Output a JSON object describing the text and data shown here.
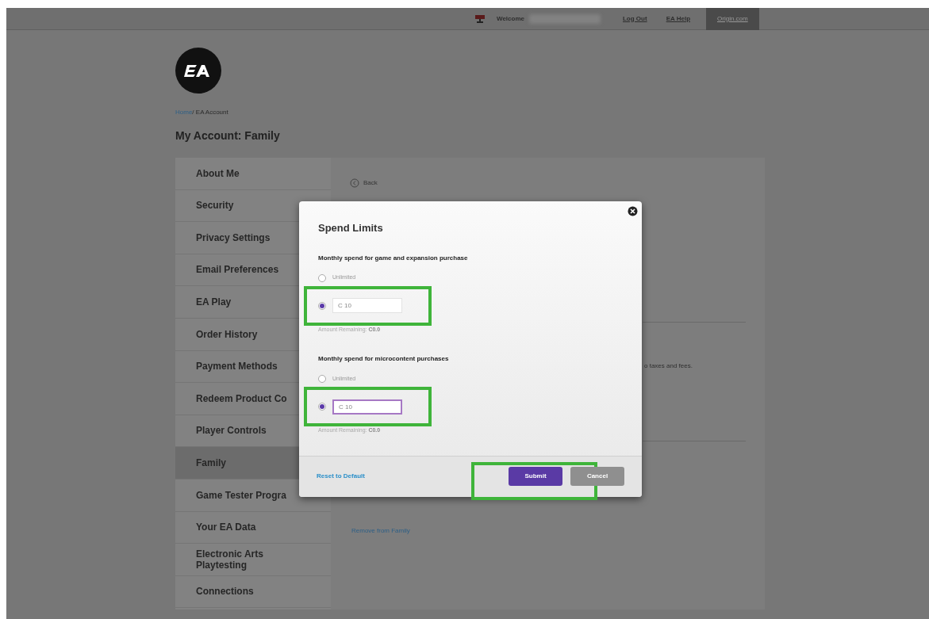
{
  "top_bar": {
    "welcome": "Welcome",
    "links": [
      {
        "label": "Log Out",
        "selected": false
      },
      {
        "label": "EA Help",
        "selected": false
      },
      {
        "label": "Origin.com",
        "selected": true
      }
    ]
  },
  "breadcrumb": {
    "home": "Home",
    "current": "/ EA Account"
  },
  "page_title": "My Account: Family",
  "sidebar": {
    "items": [
      {
        "label": "About Me",
        "selected": false
      },
      {
        "label": "Security",
        "selected": false
      },
      {
        "label": "Privacy Settings",
        "selected": false
      },
      {
        "label": "Email Preferences",
        "selected": false
      },
      {
        "label": "EA Play",
        "selected": false
      },
      {
        "label": "Order History",
        "selected": false
      },
      {
        "label": "Payment Methods",
        "selected": false
      },
      {
        "label": "Redeem Product Co",
        "selected": false
      },
      {
        "label": "Player Controls",
        "selected": false
      },
      {
        "label": "Family",
        "selected": true
      },
      {
        "label": "Game Tester Progra",
        "selected": false
      },
      {
        "label": "Your EA Data",
        "selected": false
      },
      {
        "label": "Electronic Arts Playtesting",
        "selected": false
      },
      {
        "label": "Connections",
        "selected": false
      }
    ]
  },
  "content": {
    "back": "Back",
    "note": "o taxes and fees.",
    "remove_link": "Remove from Family"
  },
  "modal": {
    "title": "Spend Limits",
    "sections": [
      {
        "label": "Monthly spend for game and expansion purchase",
        "options": [
          {
            "kind": "plain",
            "label": "Unlimited",
            "selected": false,
            "highlighted": false
          },
          {
            "kind": "amount",
            "value": "C 10",
            "selected": true,
            "focused": false,
            "highlighted": true
          }
        ],
        "remaining_label": "Amount Remaining:",
        "remaining_value": "C0.0"
      },
      {
        "label": "Monthly spend for microcontent purchases",
        "options": [
          {
            "kind": "plain",
            "label": "Unlimited",
            "selected": false,
            "highlighted": false
          },
          {
            "kind": "amount",
            "value": "C 10",
            "selected": true,
            "focused": true,
            "highlighted": true
          }
        ],
        "remaining_label": "Amount Remaining:",
        "remaining_value": "C0.0"
      }
    ],
    "reset_link": "Reset to Default",
    "buttons": [
      {
        "label": "Submit",
        "kind": "primary"
      },
      {
        "label": "Cancel",
        "kind": "secondary"
      }
    ],
    "buttons_highlighted": true
  }
}
